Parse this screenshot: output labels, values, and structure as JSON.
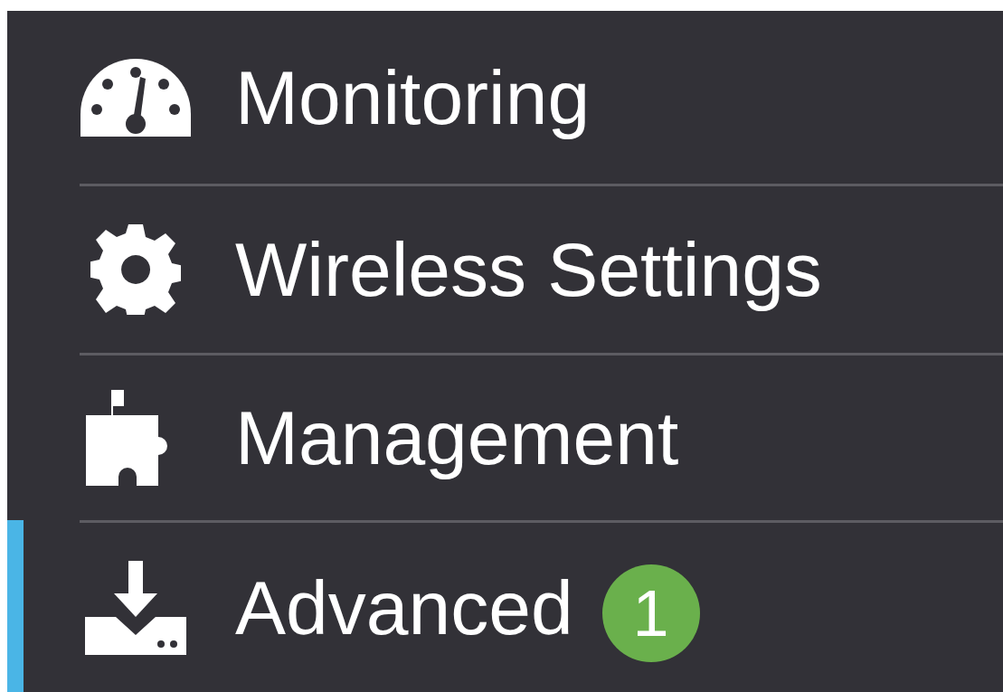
{
  "sidebar": {
    "items": [
      {
        "label": "Monitoring",
        "selected": false
      },
      {
        "label": "Wireless Settings",
        "selected": false
      },
      {
        "label": "Management",
        "selected": false
      },
      {
        "label": "Advanced",
        "selected": true,
        "badge": "1"
      }
    ]
  }
}
